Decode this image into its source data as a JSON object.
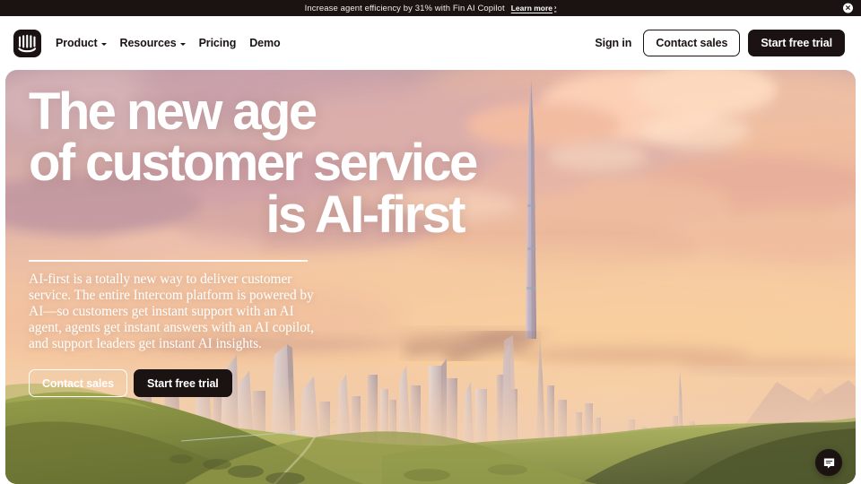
{
  "announcement": {
    "text": "Increase agent efficiency by 31% with Fin AI Copilot",
    "link_label": "Learn more",
    "link_chevron": "›",
    "close_icon": "✕",
    "background": "#1a1311",
    "text_color": "#f2ece8"
  },
  "header": {
    "logo_name": "intercom-logo",
    "nav": [
      {
        "label": "Product",
        "has_dropdown": true
      },
      {
        "label": "Resources",
        "has_dropdown": true
      },
      {
        "label": "Pricing",
        "has_dropdown": false
      },
      {
        "label": "Demo",
        "has_dropdown": false
      }
    ],
    "sign_in": "Sign in",
    "contact_sales": "Contact sales",
    "start_free_trial": "Start free trial"
  },
  "hero": {
    "headline_line1": "The new age",
    "headline_line2": "of customer service",
    "headline_line3": "is AI-first",
    "lede": "AI-first is a totally new way to deliver customer service. The entire Intercom platform is powered by AI—so customers get instant support with an AI agent, agents get instant answers with an AI copilot, and support leaders get instant AI insights.",
    "cta_secondary": "Contact sales",
    "cta_primary": "Start free trial",
    "artwork_description": "Futuristic city skyline at sunset with a tall central spire, peach and pink clouds, and green rolling hills in the foreground",
    "colors": {
      "sky_top": "#c8a9b4",
      "sky_mid": "#f3c0a4",
      "sky_low": "#f6cba8",
      "cloud_highlight": "#ffd9c0",
      "cloud_shadow": "#b98f95",
      "hill_light": "#9aa84e",
      "hill_dark": "#5f6b34",
      "city_haze": "#e4c7bd",
      "ink": "#1a1311",
      "white": "#ffffff"
    }
  },
  "chat": {
    "launcher_name": "chat-launcher",
    "icon": "speech-bubble"
  }
}
